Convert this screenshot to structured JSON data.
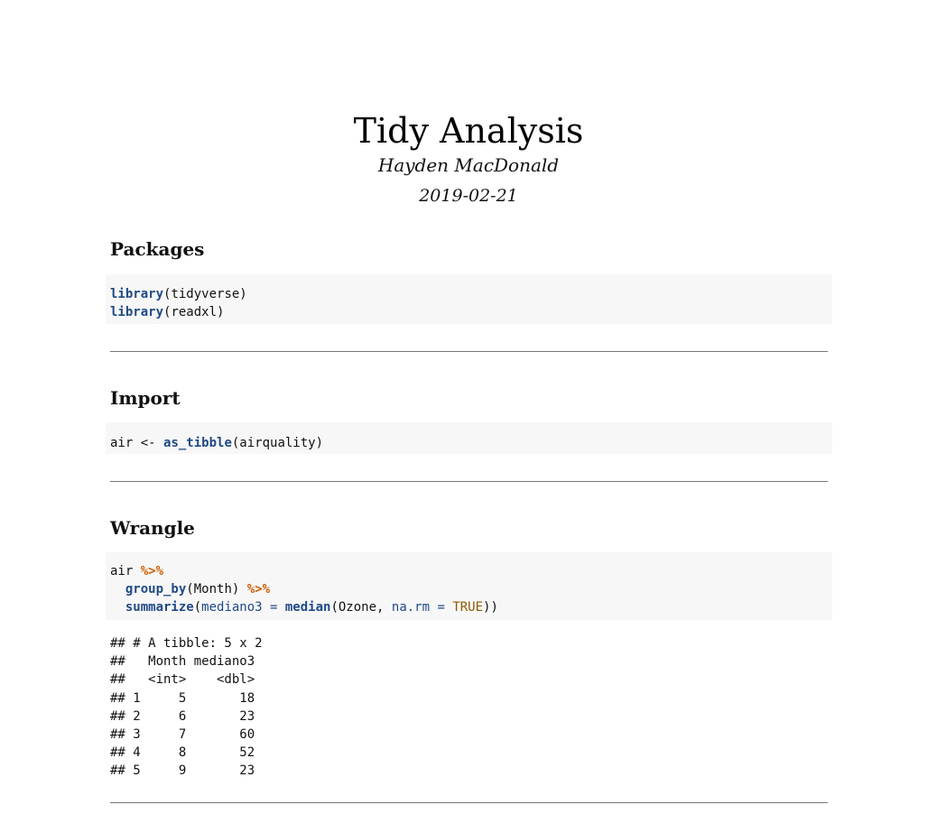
{
  "header": {
    "title": "Tidy Analysis",
    "author": "Hayden MacDonald",
    "date": "2019-02-21"
  },
  "sections": {
    "packages": {
      "heading": "Packages",
      "code": {
        "line1": {
          "fn": "library",
          "rest": "(tidyverse)"
        },
        "line2": {
          "fn": "library",
          "rest": "(readxl)"
        }
      }
    },
    "import": {
      "heading": "Import",
      "code": {
        "line1": {
          "lhs": "air <- ",
          "fn": "as_tibble",
          "rest": "(airquality)"
        }
      }
    },
    "wrangle": {
      "heading": "Wrangle",
      "code": {
        "line1": {
          "text": "air ",
          "pipe": "%>%"
        },
        "line2": {
          "indent": "  ",
          "fn": "group_by",
          "rest": "(Month) ",
          "pipe": "%>%"
        },
        "line3": {
          "indent": "  ",
          "fn": "summarize",
          "open": "(",
          "arg": "mediano3 = ",
          "fn2": "median",
          "mid": "(Ozone, ",
          "arg2": "na.rm = ",
          "const": "TRUE",
          "close": "))"
        }
      },
      "output": [
        "## # A tibble: 5 x 2",
        "##   Month mediano3",
        "##   <int>    <dbl>",
        "## 1     5       18",
        "## 2     6       23",
        "## 3     7       60",
        "## 4     8       52",
        "## 5     9       23"
      ]
    }
  },
  "colors": {
    "code_background": "#f7f7f7",
    "keyword": "#204a87",
    "operator": "#ce5c00",
    "constant": "#8f5902",
    "rule": "#777777"
  }
}
